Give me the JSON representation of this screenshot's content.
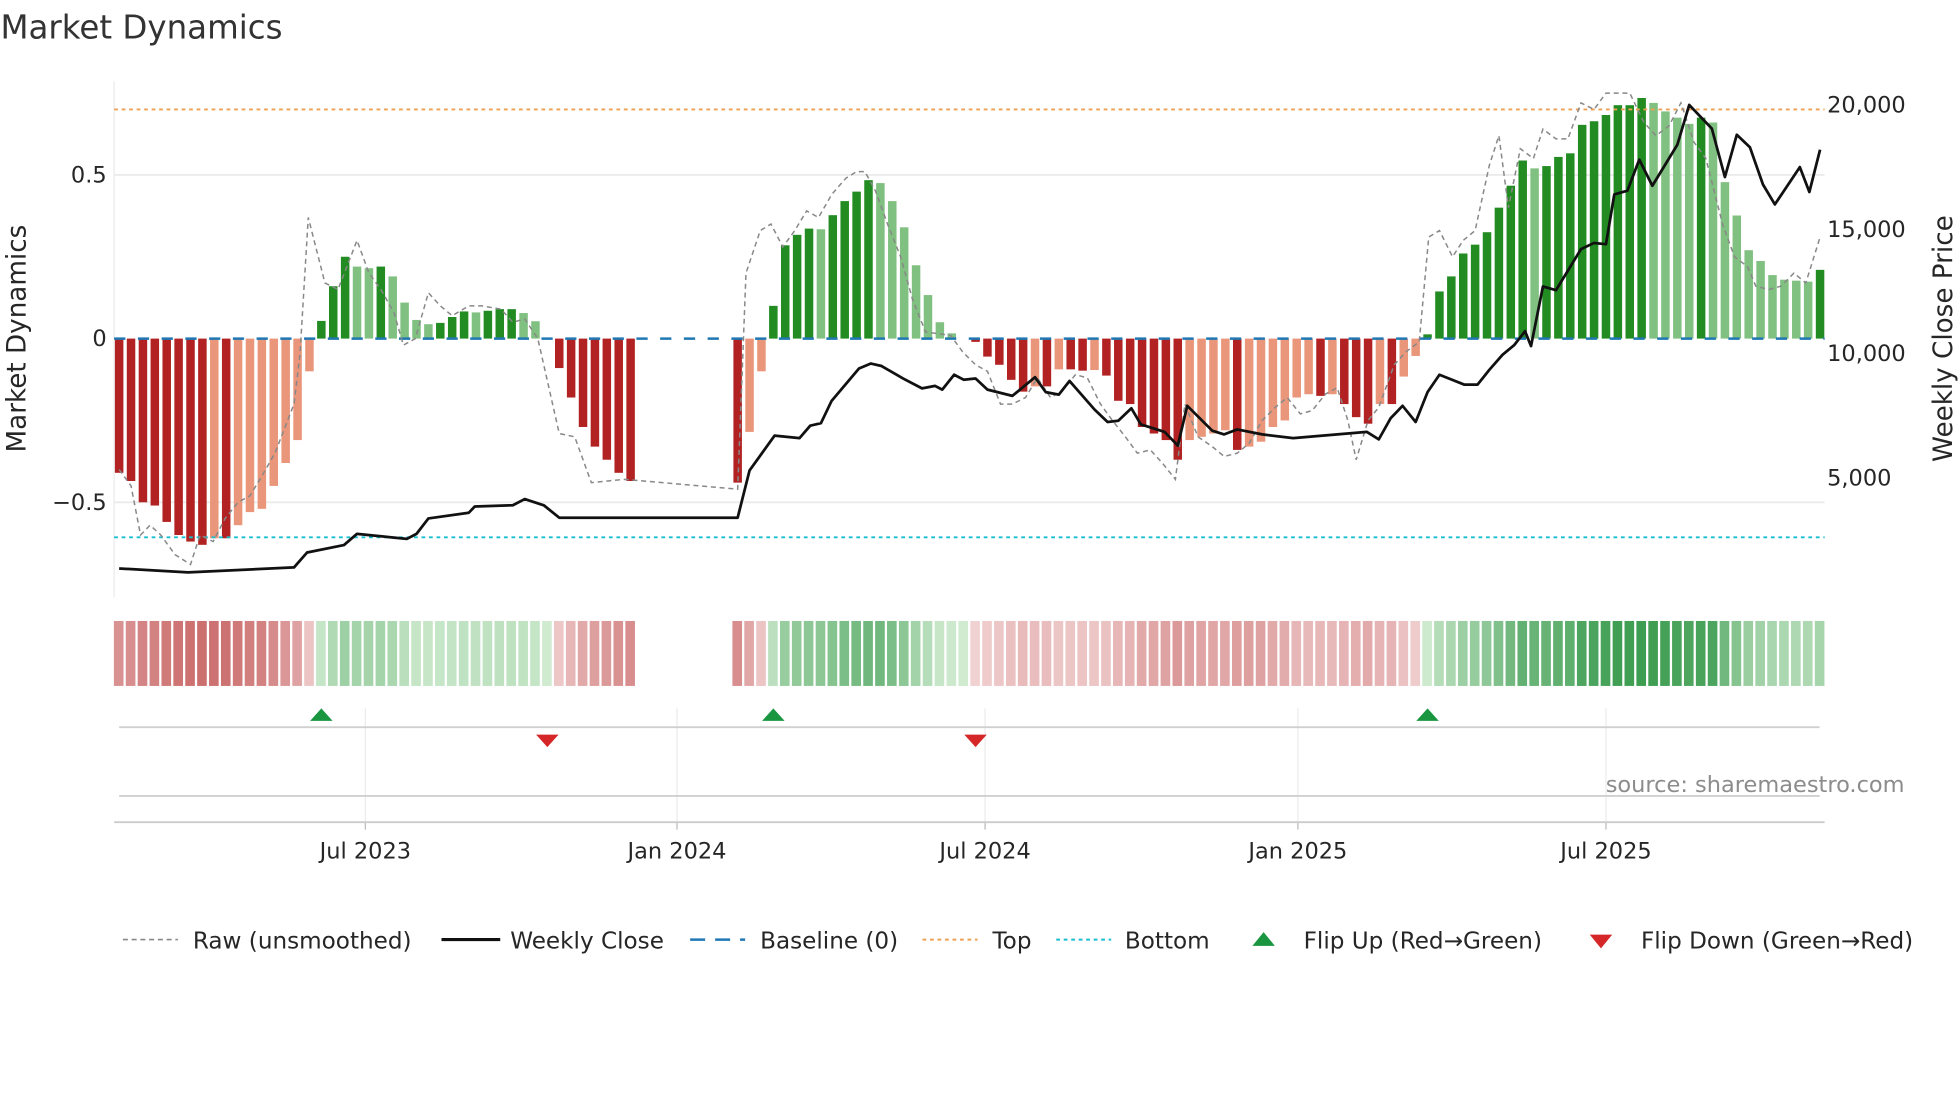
{
  "chart_data": {
    "type": "bar",
    "title": "Market Dynamics",
    "ylabel": "Market Dynamics",
    "y2label": "Weekly Close Price",
    "ylim": [
      -0.8,
      0.78
    ],
    "y2lim": [
      0,
      21000
    ],
    "yticks": [
      {
        "v": 0.5,
        "label": "0.5"
      },
      {
        "v": 0,
        "label": "0"
      },
      {
        "v": -0.5,
        "label": "−0.5"
      }
    ],
    "y2ticks": [
      {
        "v": 20000,
        "label": "20,000"
      },
      {
        "v": 15000,
        "label": "15,000"
      },
      {
        "v": 10000,
        "label": "10,000"
      },
      {
        "v": 5000,
        "label": "5,000"
      }
    ],
    "xticks": [
      {
        "week": 20.7,
        "label": "Jul 2023"
      },
      {
        "week": 46.9,
        "label": "Jan 2024"
      },
      {
        "week": 72.8,
        "label": "Jul 2024"
      },
      {
        "week": 99.1,
        "label": "Jan 2025"
      },
      {
        "week": 125,
        "label": "Jul 2025"
      }
    ],
    "x_unit": "week index",
    "top_level": 0.7,
    "bottom_level": -0.607,
    "baseline": 0,
    "momentum": [
      -0.41,
      -0.435,
      -0.5,
      -0.51,
      -0.56,
      -0.6,
      -0.62,
      -0.63,
      -0.61,
      -0.61,
      -0.57,
      -0.53,
      -0.52,
      -0.45,
      -0.38,
      -0.31,
      -0.1,
      0.054,
      0.16,
      0.25,
      0.22,
      0.215,
      0.22,
      0.19,
      0.11,
      0.057,
      0.044,
      0.048,
      0.066,
      0.083,
      0.08,
      0.085,
      0.09,
      0.09,
      0.078,
      0.053,
      0,
      -0.09,
      -0.18,
      -0.27,
      -0.33,
      -0.37,
      -0.41,
      -0.435,
      null,
      null,
      null,
      null,
      null,
      null,
      null,
      null,
      -0.44,
      -0.285,
      -0.1,
      0.1,
      0.285,
      0.317,
      0.336,
      0.334,
      0.377,
      0.42,
      0.449,
      0.484,
      0.475,
      0.42,
      0.34,
      0.224,
      0.133,
      0.05,
      0.016,
      0,
      -0.01,
      -0.055,
      -0.08,
      -0.126,
      -0.162,
      -0.146,
      -0.146,
      -0.094,
      -0.094,
      -0.098,
      -0.096,
      -0.113,
      -0.19,
      -0.2,
      -0.27,
      -0.29,
      -0.31,
      -0.37,
      -0.31,
      -0.3,
      -0.29,
      -0.28,
      -0.34,
      -0.33,
      -0.315,
      -0.27,
      -0.25,
      -0.18,
      -0.17,
      -0.175,
      -0.17,
      -0.2,
      -0.24,
      -0.26,
      -0.2,
      -0.2,
      -0.116,
      -0.053,
      0.013,
      0.144,
      0.19,
      0.26,
      0.287,
      0.325,
      0.4,
      0.467,
      0.544,
      0.52,
      0.527,
      0.555,
      0.566,
      0.653,
      0.664,
      0.683,
      0.713,
      0.713,
      0.735,
      0.72,
      0.694,
      0.675,
      0.656,
      0.675,
      0.66,
      0.478,
      0.376,
      0.27,
      0.237,
      0.194,
      0.18,
      0.177,
      0.174,
      0.21
    ],
    "raw": [
      [
        0,
        -0.4
      ],
      [
        1,
        -0.45
      ],
      [
        1.8,
        -0.6
      ],
      [
        2.6,
        -0.57
      ],
      [
        3.5,
        -0.6
      ],
      [
        4.7,
        -0.66
      ],
      [
        6,
        -0.69
      ],
      [
        6.8,
        -0.6
      ],
      [
        7.9,
        -0.62
      ],
      [
        8.9,
        -0.55
      ],
      [
        10,
        -0.5
      ],
      [
        11,
        -0.48
      ],
      [
        12,
        -0.42
      ],
      [
        13.1,
        -0.35
      ],
      [
        14.7,
        -0.2
      ],
      [
        15.2,
        -0.05
      ],
      [
        15.9,
        0.37
      ],
      [
        17.3,
        0.17
      ],
      [
        18.4,
        0.15
      ],
      [
        20,
        0.3
      ],
      [
        21,
        0.2
      ],
      [
        22,
        0.15
      ],
      [
        23.1,
        0.08
      ],
      [
        23.9,
        -0.02
      ],
      [
        24.9,
        0
      ],
      [
        26,
        0.14
      ],
      [
        27,
        0.1
      ],
      [
        28,
        0.07
      ],
      [
        29.4,
        0.1
      ],
      [
        30.5,
        0.1
      ],
      [
        32.1,
        0.09
      ],
      [
        33.1,
        0.05
      ],
      [
        34.1,
        0.06
      ],
      [
        35.2,
        0
      ],
      [
        37,
        -0.29
      ],
      [
        38.3,
        -0.3
      ],
      [
        39.7,
        -0.44
      ],
      [
        42.5,
        -0.43
      ],
      [
        52,
        -0.46
      ],
      [
        52.7,
        0.2
      ],
      [
        53.9,
        0.33
      ],
      [
        54.8,
        0.35
      ],
      [
        55.8,
        0.28
      ],
      [
        56.8,
        0.33
      ],
      [
        57.8,
        0.39
      ],
      [
        58.8,
        0.37
      ],
      [
        59.9,
        0.44
      ],
      [
        61.1,
        0.49
      ],
      [
        62,
        0.51
      ],
      [
        62.7,
        0.51
      ],
      [
        63.6,
        0.45
      ],
      [
        64.6,
        0.35
      ],
      [
        65.7,
        0.25
      ],
      [
        66.7,
        0.12
      ],
      [
        67.8,
        0.02
      ],
      [
        69.9,
        0.01
      ],
      [
        70.9,
        -0.04
      ],
      [
        72,
        -0.08
      ],
      [
        73,
        -0.1
      ],
      [
        74.1,
        -0.2
      ],
      [
        75.1,
        -0.2
      ],
      [
        76.2,
        -0.18
      ],
      [
        77.2,
        -0.12
      ],
      [
        78.3,
        -0.18
      ],
      [
        79.3,
        -0.16
      ],
      [
        80.4,
        -0.11
      ],
      [
        81.4,
        -0.12
      ],
      [
        82.5,
        -0.2
      ],
      [
        83.5,
        -0.25
      ],
      [
        84.6,
        -0.3
      ],
      [
        85.6,
        -0.35
      ],
      [
        86.7,
        -0.34
      ],
      [
        87.7,
        -0.38
      ],
      [
        88.8,
        -0.43
      ],
      [
        89.6,
        -0.2
      ],
      [
        90.7,
        -0.3
      ],
      [
        91.9,
        -0.33
      ],
      [
        92.9,
        -0.36
      ],
      [
        94,
        -0.35
      ],
      [
        95,
        -0.32
      ],
      [
        96.1,
        -0.25
      ],
      [
        97.2,
        -0.21
      ],
      [
        98.2,
        -0.18
      ],
      [
        99.3,
        -0.23
      ],
      [
        100.3,
        -0.22
      ],
      [
        101.4,
        -0.17
      ],
      [
        102.4,
        -0.15
      ],
      [
        103.3,
        -0.25
      ],
      [
        104,
        -0.37
      ],
      [
        105,
        -0.25
      ],
      [
        105.9,
        -0.21
      ],
      [
        107.2,
        -0.08
      ],
      [
        108.2,
        -0.04
      ],
      [
        109.3,
        -0.01
      ],
      [
        110.1,
        0.31
      ],
      [
        111,
        0.33
      ],
      [
        112.1,
        0.25
      ],
      [
        113,
        0.3
      ],
      [
        114,
        0.33
      ],
      [
        115.2,
        0.53
      ],
      [
        116,
        0.62
      ],
      [
        116.8,
        0.4
      ],
      [
        117.8,
        0.58
      ],
      [
        118.9,
        0.55
      ],
      [
        119.7,
        0.64
      ],
      [
        120.8,
        0.61
      ],
      [
        121.8,
        0.61
      ],
      [
        122.9,
        0.72
      ],
      [
        124,
        0.7
      ],
      [
        125,
        0.75
      ],
      [
        127,
        0.75
      ],
      [
        128.2,
        0.66
      ],
      [
        129.2,
        0.62
      ],
      [
        130.3,
        0.65
      ],
      [
        131.3,
        0.72
      ],
      [
        132.4,
        0.6
      ],
      [
        133.4,
        0.55
      ],
      [
        134.8,
        0.35
      ],
      [
        135.8,
        0.25
      ],
      [
        136.9,
        0.22
      ],
      [
        137.6,
        0.16
      ],
      [
        138.7,
        0.15
      ],
      [
        139.7,
        0.16
      ],
      [
        140.8,
        0.2
      ],
      [
        141.8,
        0.17
      ],
      [
        143,
        0.31
      ]
    ],
    "close": [
      [
        0,
        1357
      ],
      [
        5.8,
        1200
      ],
      [
        14.7,
        1400
      ],
      [
        15.8,
        2000
      ],
      [
        18.9,
        2300
      ],
      [
        20,
        2750
      ],
      [
        23.1,
        2600
      ],
      [
        24.2,
        2550
      ],
      [
        25,
        2750
      ],
      [
        26,
        3370
      ],
      [
        29.4,
        3600
      ],
      [
        29.9,
        3850
      ],
      [
        33.1,
        3900
      ],
      [
        34.1,
        4150
      ],
      [
        35.7,
        3900
      ],
      [
        37,
        3400
      ],
      [
        52,
        3400
      ],
      [
        53,
        5300
      ],
      [
        55.1,
        6700
      ],
      [
        57.2,
        6600
      ],
      [
        58.1,
        7100
      ],
      [
        59,
        7200
      ],
      [
        59.9,
        8100
      ],
      [
        62.2,
        9400
      ],
      [
        63.2,
        9600
      ],
      [
        64.1,
        9500
      ],
      [
        65.9,
        9000
      ],
      [
        67.5,
        8600
      ],
      [
        68.6,
        8700
      ],
      [
        69.2,
        8550
      ],
      [
        70.2,
        9150
      ],
      [
        71,
        8950
      ],
      [
        72,
        9000
      ],
      [
        73,
        8550
      ],
      [
        75.1,
        8300
      ],
      [
        77,
        9050
      ],
      [
        77.9,
        8450
      ],
      [
        79,
        8350
      ],
      [
        79.9,
        8900
      ],
      [
        82,
        7750
      ],
      [
        83.1,
        7250
      ],
      [
        84,
        7300
      ],
      [
        85.1,
        7800
      ],
      [
        85.9,
        7150
      ],
      [
        87.9,
        6850
      ],
      [
        89,
        6300
      ],
      [
        89.8,
        7900
      ],
      [
        91.9,
        6900
      ],
      [
        92.9,
        6750
      ],
      [
        94,
        6950
      ],
      [
        96.1,
        6750
      ],
      [
        98.7,
        6600
      ],
      [
        104.9,
        6850
      ],
      [
        105.9,
        6550
      ],
      [
        106.9,
        7400
      ],
      [
        107.9,
        7900
      ],
      [
        109,
        7250
      ],
      [
        110,
        8450
      ],
      [
        111,
        9150
      ],
      [
        113.1,
        8750
      ],
      [
        114.2,
        8750
      ],
      [
        115.2,
        9350
      ],
      [
        116.3,
        9950
      ],
      [
        117.3,
        10350
      ],
      [
        118.2,
        10900
      ],
      [
        118.7,
        10300
      ],
      [
        119.7,
        12700
      ],
      [
        120.8,
        12550
      ],
      [
        122.9,
        14200
      ],
      [
        124,
        14450
      ],
      [
        125,
        14400
      ],
      [
        125.7,
        16400
      ],
      [
        126.8,
        16550
      ],
      [
        127.8,
        17800
      ],
      [
        128.9,
        16750
      ],
      [
        131,
        18400
      ],
      [
        132,
        20000
      ],
      [
        133.9,
        19050
      ],
      [
        135,
        17100
      ],
      [
        136,
        18800
      ],
      [
        137.1,
        18300
      ],
      [
        138.2,
        16800
      ],
      [
        139.2,
        16000
      ],
      [
        141.3,
        17500
      ],
      [
        142.1,
        16500
      ],
      [
        143,
        18200
      ]
    ],
    "flips_up": [
      17,
      55,
      110
    ],
    "flips_down": [
      36,
      72
    ],
    "colors": {
      "dark_red": "#b22222",
      "light_red": "#e9967a",
      "dark_green": "#228b22",
      "light_green": "#80c080",
      "top": "#f0a050",
      "bottom": "#17becf",
      "baseline": "#1f77b4",
      "flip_up": "#1a9641",
      "flip_down": "#d62728"
    },
    "legend": {
      "raw": "Raw (unsmoothed)",
      "close": "Weekly Close",
      "baseline": "Baseline (0)",
      "top": "Top",
      "bottom": "Bottom",
      "flip_up": "Flip Up (Red→Green)",
      "flip_down": "Flip Down (Green→Red)"
    },
    "legend_position": "bottom",
    "source": "source: sharemaestro.com"
  }
}
